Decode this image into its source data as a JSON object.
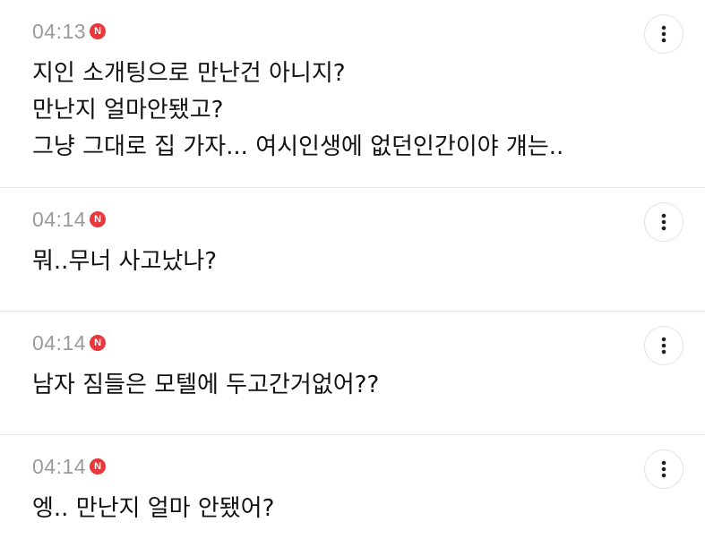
{
  "comments": [
    {
      "time": "04:13",
      "badge": "N",
      "lines": [
        "지인 소개팅으로 만난건 아니지?",
        "만난지 얼마안됐고?",
        "그냥 그대로 집 가자... 여시인생에 없던인간이야 걔는.."
      ]
    },
    {
      "time": "04:14",
      "badge": "N",
      "lines": [
        "뭐..무너 사고났나?"
      ]
    },
    {
      "time": "04:14",
      "badge": "N",
      "lines": [
        "남자 짐들은 모텔에 두고간거없어??"
      ]
    },
    {
      "time": "04:14",
      "badge": "N",
      "lines": [
        "엥.. 만난지 얼마 안됐어?"
      ]
    }
  ],
  "icons": {
    "new_badge": "new-badge-icon",
    "more": "more-vertical-icon"
  },
  "colors": {
    "badge": "#e8383d",
    "time": "#9a9a9a",
    "text": "#111111",
    "divider": "#e4e4e4"
  }
}
